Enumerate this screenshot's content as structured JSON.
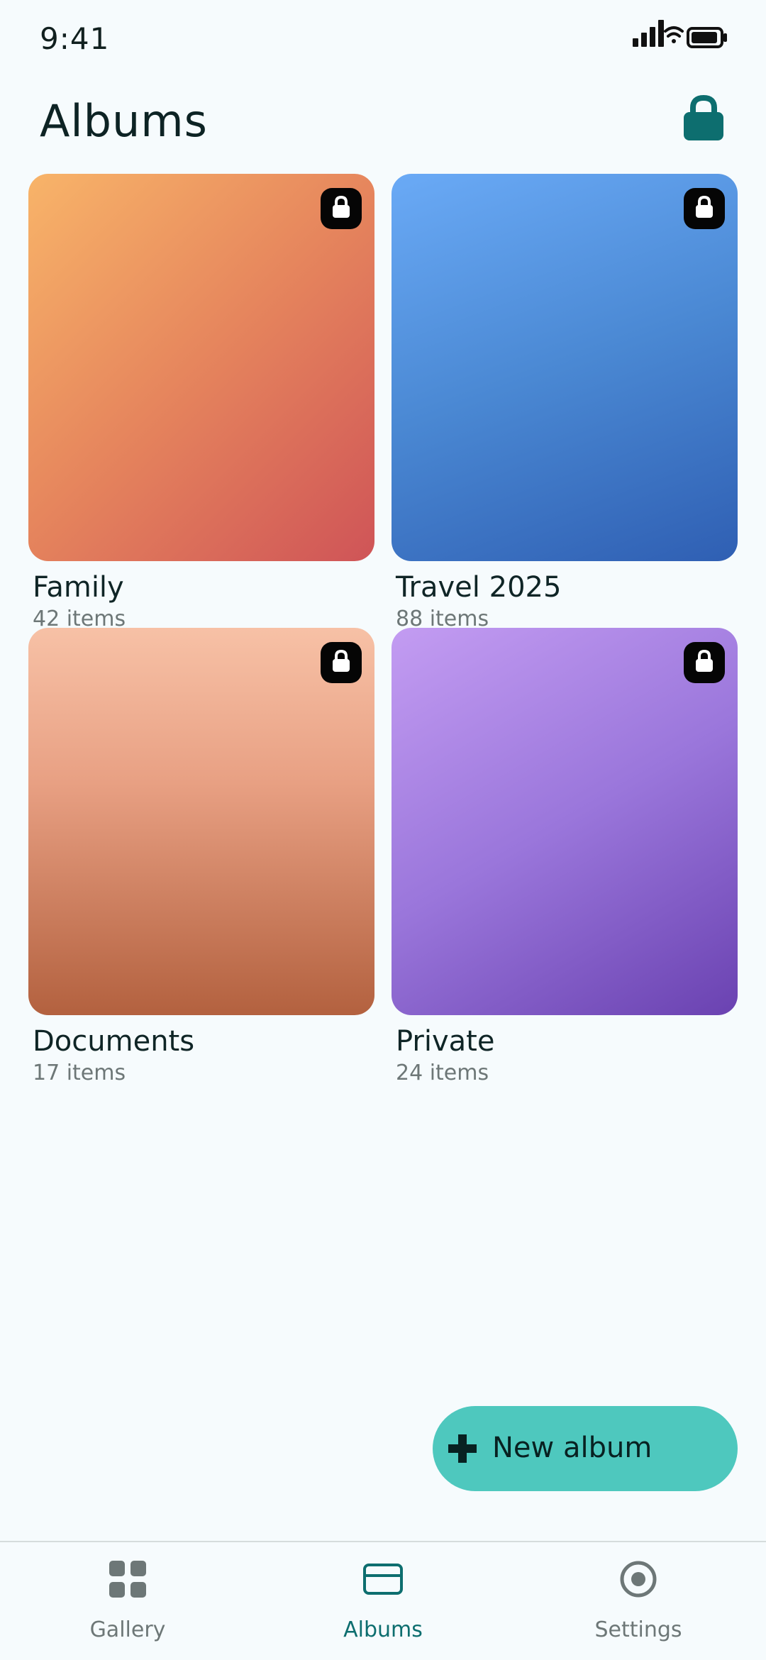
{
  "status_bar": {
    "time": "9:41",
    "icons": [
      "signal-icon",
      "wifi-icon",
      "battery-icon"
    ]
  },
  "header": {
    "title": "Albums",
    "lock_icon": "lock-icon"
  },
  "albums": [
    {
      "name": "Family",
      "count": "42 items",
      "cover_colors": [
        "#f8b469",
        "#e6865d",
        "#cf5457"
      ],
      "locked": true
    },
    {
      "name": "Travel 2025",
      "count": "88 items",
      "cover_colors": [
        "#6aaaf6",
        "#4a88d3",
        "#2f5fb3"
      ],
      "locked": true
    },
    {
      "name": "Documents",
      "count": "17 items",
      "cover_colors": [
        "#f7c1a6",
        "#e8a083",
        "#b3613f"
      ],
      "locked": true
    },
    {
      "name": "Private",
      "count": "24 items",
      "cover_colors": [
        "#c39cf2",
        "#9a76db",
        "#6a42b1"
      ],
      "locked": true
    }
  ],
  "fab": {
    "label": "New album",
    "icon": "plus-icon"
  },
  "bottom_nav": {
    "items": [
      {
        "label": "Gallery",
        "icon": "grid-icon",
        "active": false
      },
      {
        "label": "Albums",
        "icon": "album-icon",
        "active": true
      },
      {
        "label": "Settings",
        "icon": "settings-icon",
        "active": false
      }
    ]
  },
  "colors": {
    "background": "#f6fbfd",
    "accent": "#0d6e6f",
    "fab": "#4ec8be",
    "text_primary": "#0f2526",
    "text_secondary": "#6d7777"
  }
}
